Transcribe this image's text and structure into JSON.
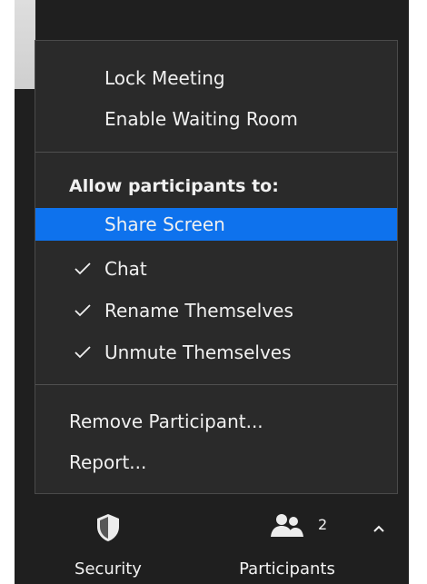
{
  "menu": {
    "top_items": [
      {
        "label": "Lock Meeting"
      },
      {
        "label": "Enable Waiting Room"
      }
    ],
    "section_title": "Allow participants to:",
    "permissions": [
      {
        "label": "Share Screen",
        "checked": false,
        "selected": true
      },
      {
        "label": "Chat",
        "checked": true,
        "selected": false
      },
      {
        "label": "Rename Themselves",
        "checked": true,
        "selected": false
      },
      {
        "label": "Unmute Themselves",
        "checked": true,
        "selected": false
      }
    ],
    "bottom_items": [
      {
        "label": "Remove Participant..."
      },
      {
        "label": "Report..."
      }
    ]
  },
  "toolbar": {
    "security_label": "Security",
    "participants_label": "Participants",
    "participant_count": "2"
  },
  "icons": {
    "security": "shield-icon",
    "participants": "participants-icon",
    "check": "checkmark-icon",
    "caret": "chevron-up-icon"
  },
  "colors": {
    "menu_background": "#2a2a2a",
    "highlight": "#0e72ed",
    "app_background": "#1f1f1f",
    "text": "#f0f0f0"
  }
}
